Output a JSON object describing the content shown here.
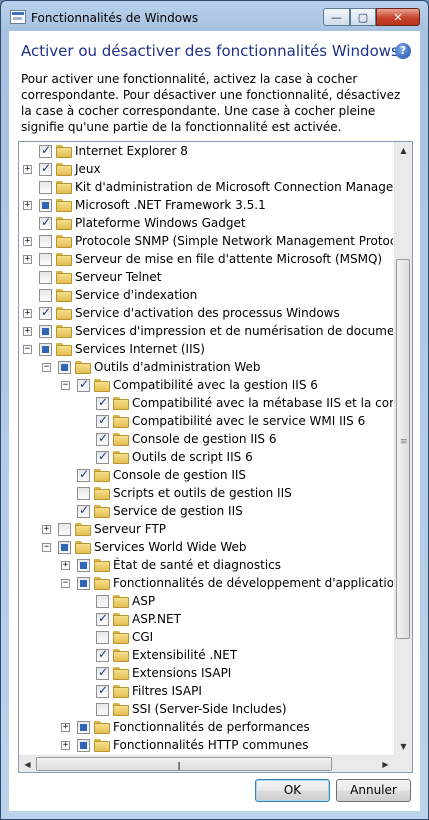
{
  "window": {
    "title": "Fonctionnalités de Windows",
    "controls": {
      "minimize": "—",
      "maximize": "▢",
      "close": "✕"
    }
  },
  "header": {
    "heading": "Activer ou désactiver des fonctionnalités Windows",
    "help": "?",
    "description": "Pour activer une fonctionnalité, activez la case à cocher correspondante. Pour désactiver une fonctionnalité, désactivez la case à cocher correspondante. Une case à cocher pleine signifie qu'une partie de la fonctionnalité est activée."
  },
  "tree": {
    "items": [
      {
        "label": "Internet Explorer 8",
        "level": 0,
        "expander": "",
        "state": "checked"
      },
      {
        "label": "Jeux",
        "level": 0,
        "expander": "+",
        "state": "checked"
      },
      {
        "label": "Kit d'administration de Microsoft Connection Manager (CMA",
        "level": 0,
        "expander": "",
        "state": "unchecked"
      },
      {
        "label": "Microsoft .NET Framework 3.5.1",
        "level": 0,
        "expander": "+",
        "state": "partial"
      },
      {
        "label": "Plateforme Windows Gadget",
        "level": 0,
        "expander": "",
        "state": "checked"
      },
      {
        "label": "Protocole SNMP (Simple Network Management Protocol)",
        "level": 0,
        "expander": "+",
        "state": "unchecked"
      },
      {
        "label": "Serveur de mise en file d'attente Microsoft (MSMQ)",
        "level": 0,
        "expander": "+",
        "state": "unchecked"
      },
      {
        "label": "Serveur Telnet",
        "level": 0,
        "expander": "",
        "state": "unchecked"
      },
      {
        "label": "Service d'indexation",
        "level": 0,
        "expander": "",
        "state": "unchecked"
      },
      {
        "label": "Service d'activation des processus Windows",
        "level": 0,
        "expander": "+",
        "state": "checked"
      },
      {
        "label": "Services d'impression et de numérisation de document",
        "level": 0,
        "expander": "+",
        "state": "partial"
      },
      {
        "label": "Services Internet (IIS)",
        "level": 0,
        "expander": "−",
        "state": "partial"
      },
      {
        "label": "Outils d'administration Web",
        "level": 1,
        "expander": "−",
        "state": "partial"
      },
      {
        "label": "Compatibilité avec la gestion IIS 6",
        "level": 2,
        "expander": "−",
        "state": "checked"
      },
      {
        "label": "Compatibilité avec la métabase IIS et la configurati",
        "level": 3,
        "expander": "",
        "state": "checked"
      },
      {
        "label": "Compatibilité avec le service WMI IIS 6",
        "level": 3,
        "expander": "",
        "state": "checked"
      },
      {
        "label": "Console de gestion IIS 6",
        "level": 3,
        "expander": "",
        "state": "checked"
      },
      {
        "label": "Outils de script IIS 6",
        "level": 3,
        "expander": "",
        "state": "checked"
      },
      {
        "label": "Console de gestion IIS",
        "level": 2,
        "expander": "",
        "state": "checked"
      },
      {
        "label": "Scripts et outils de gestion IIS",
        "level": 2,
        "expander": "",
        "state": "unchecked"
      },
      {
        "label": "Service de gestion IIS",
        "level": 2,
        "expander": "",
        "state": "checked"
      },
      {
        "label": "Serveur FTP",
        "level": 1,
        "expander": "+",
        "state": "unchecked"
      },
      {
        "label": "Services World Wide Web",
        "level": 1,
        "expander": "−",
        "state": "partial"
      },
      {
        "label": "État de santé et diagnostics",
        "level": 2,
        "expander": "+",
        "state": "partial"
      },
      {
        "label": "Fonctionnalités de développement d'applications",
        "level": 2,
        "expander": "−",
        "state": "partial"
      },
      {
        "label": "ASP",
        "level": 3,
        "expander": "",
        "state": "unchecked"
      },
      {
        "label": "ASP.NET",
        "level": 3,
        "expander": "",
        "state": "checked"
      },
      {
        "label": "CGI",
        "level": 3,
        "expander": "",
        "state": "unchecked"
      },
      {
        "label": "Extensibilité .NET",
        "level": 3,
        "expander": "",
        "state": "checked"
      },
      {
        "label": "Extensions ISAPI",
        "level": 3,
        "expander": "",
        "state": "checked"
      },
      {
        "label": "Filtres ISAPI",
        "level": 3,
        "expander": "",
        "state": "checked"
      },
      {
        "label": "SSI (Server-Side Includes)",
        "level": 3,
        "expander": "",
        "state": "unchecked"
      },
      {
        "label": "Fonctionnalités de performances",
        "level": 2,
        "expander": "+",
        "state": "partial"
      },
      {
        "label": "Fonctionnalités HTTP communes",
        "level": 2,
        "expander": "+",
        "state": "partial"
      }
    ]
  },
  "scrollbars": {
    "up": "▲",
    "down": "▼",
    "left": "◀",
    "right": "▶",
    "vgrip": "≡",
    "hgrip": "|||"
  },
  "buttons": {
    "ok": "OK",
    "cancel": "Annuler"
  }
}
